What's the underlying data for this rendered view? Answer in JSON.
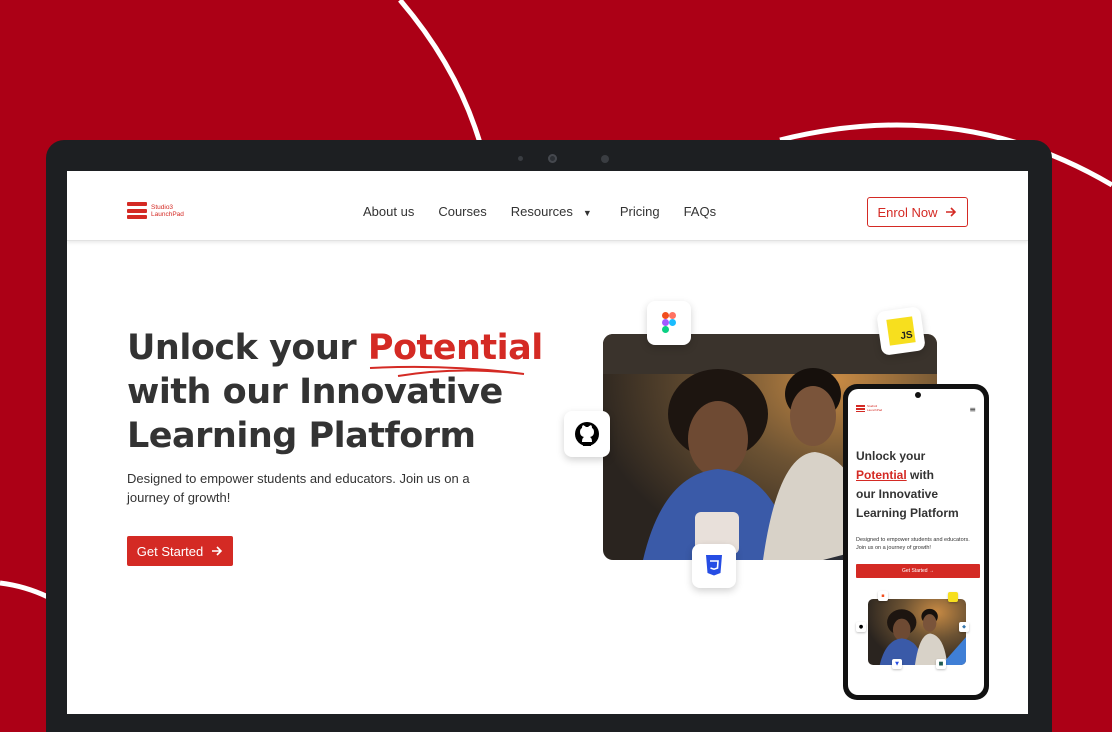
{
  "brand": {
    "line1": "Studio3",
    "line2": "LaunchPad",
    "accent_color": "#d42a24",
    "background_color": "#ac0016"
  },
  "nav": {
    "items": [
      {
        "label": "About us"
      },
      {
        "label": "Courses"
      },
      {
        "label": "Resources"
      },
      {
        "label": "Pricing"
      },
      {
        "label": "FAQs"
      }
    ],
    "enrol_label": "Enrol Now"
  },
  "hero": {
    "line1_start": "Unlock your ",
    "line1_accent": "Potential",
    "line2": "with our Innovative",
    "line3": "Learning Platform",
    "subtitle": "Designed to empower students and educators. Join us on a journey of growth!",
    "cta_label": "Get Started"
  },
  "tech_icons": [
    "figma-icon",
    "javascript-icon",
    "github-icon",
    "css3-icon"
  ],
  "tech_labels": {
    "javascript": "JS"
  },
  "mobile": {
    "title_line1": "Unlock your",
    "title_accent": "Potential",
    "title_after_accent": " with",
    "title_line3": "our Innovative",
    "title_line4": "Learning Platform",
    "subtitle": "Designed to empower students and educators. Join us on a journey of growth!",
    "cta_label": "Get Started"
  }
}
